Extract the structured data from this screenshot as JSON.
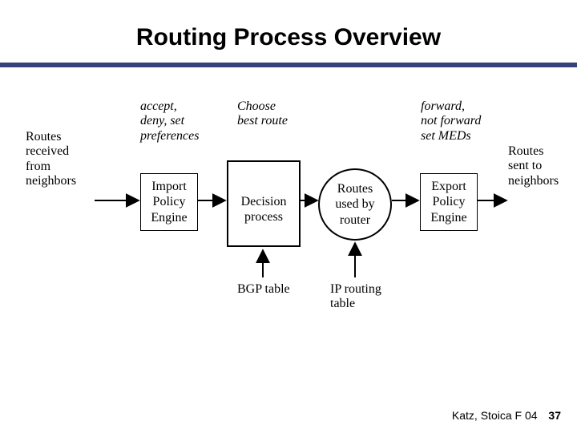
{
  "title": "Routing Process Overview",
  "labels": {
    "routes_in": "Routes\nreceived\nfrom\nneighbors",
    "accept": "accept,\ndeny, set\npreferences",
    "choose": "Choose\nbest route",
    "forward": "forward,\nnot forward\nset MEDs",
    "routes_out": "Routes\nsent to\nneighbors",
    "bgp_table": "BGP table",
    "ip_table": "IP routing\ntable"
  },
  "nodes": {
    "import_engine": "Import\nPolicy\nEngine",
    "decision": "Decision\nprocess",
    "routes_used": "Routes\nused by\nrouter",
    "export_engine": "Export\nPolicy\nEngine"
  },
  "footer": {
    "credit": "Katz, Stoica F 04",
    "page": "37"
  }
}
